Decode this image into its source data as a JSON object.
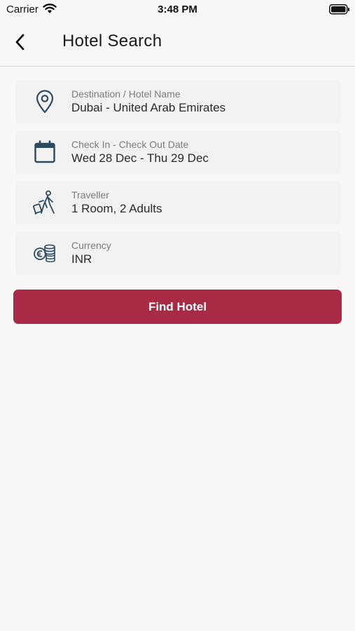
{
  "status_bar": {
    "carrier": "Carrier",
    "time": "3:48 PM",
    "icons": [
      "wifi-icon",
      "battery-icon"
    ]
  },
  "nav": {
    "title": "Hotel Search",
    "back_icon": "chevron-left-icon"
  },
  "fields": [
    {
      "icon": "location-pin-icon",
      "label": "Destination / Hotel Name",
      "value": "Dubai - United Arab Emirates"
    },
    {
      "icon": "calendar-icon",
      "label": "Check In - Check Out Date",
      "value": "Wed 28 Dec - Thu 29 Dec"
    },
    {
      "icon": "traveller-luggage-icon",
      "label": "Traveller",
      "value": "1 Room, 2 Adults"
    },
    {
      "icon": "currency-coins-icon",
      "label": "Currency",
      "value": "INR"
    }
  ],
  "action": {
    "label": "Find Hotel"
  },
  "colors": {
    "background": "#f8f8f8",
    "card": "#f2f2f2",
    "icon": "#2c4a5e",
    "button": "#a82a45",
    "button_text": "#ffffff"
  }
}
